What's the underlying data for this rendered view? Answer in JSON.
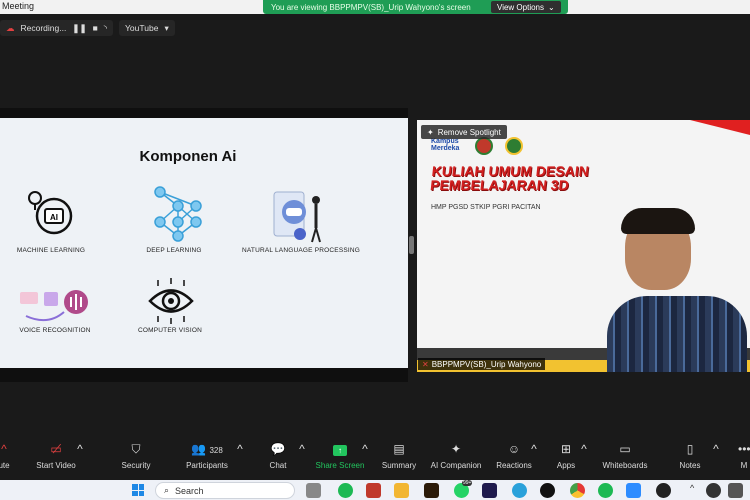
{
  "window": {
    "title": "Meeting"
  },
  "banner": {
    "message": "You are viewing BBPPMPV(SB)_Urip Wahyono's screen",
    "view_options": "View Options"
  },
  "recording": {
    "label": "Recording...",
    "stream": "YouTube"
  },
  "slide": {
    "title": "Komponen Ai",
    "components": [
      "MACHINE LEARNING",
      "DEEP LEARNING",
      "NATURAL LANGUAGE PROCESSING",
      "VOICE RECOGNITION",
      "COMPUTER VISION"
    ]
  },
  "speaker": {
    "remove_spotlight": "Remove Spotlight",
    "heading_line1": "KULIAH UMUM DESAIN",
    "heading_line2": "PEMBELAJARAN 3D",
    "subtitle": "HMP PGSD STKIP PGRI PACITAN",
    "name": "BBPPMPV(SB)_Urip Wahyono",
    "logo_text": "Kampus Merdeka"
  },
  "toolbar": {
    "mute": "ute",
    "start_video": "Start Video",
    "security": "Security",
    "participants": "Participants",
    "participants_count": "328",
    "chat": "Chat",
    "share_screen": "Share Screen",
    "summary": "Summary",
    "ai_companion": "AI Companion",
    "reactions": "Reactions",
    "apps": "Apps",
    "whiteboards": "Whiteboards",
    "notes": "Notes",
    "more": "M"
  },
  "taskbar": {
    "search_placeholder": "Search",
    "badge": "99+"
  },
  "colors": {
    "banner": "#1f9d55",
    "share": "#22c55e",
    "accent_red": "#d32020"
  }
}
